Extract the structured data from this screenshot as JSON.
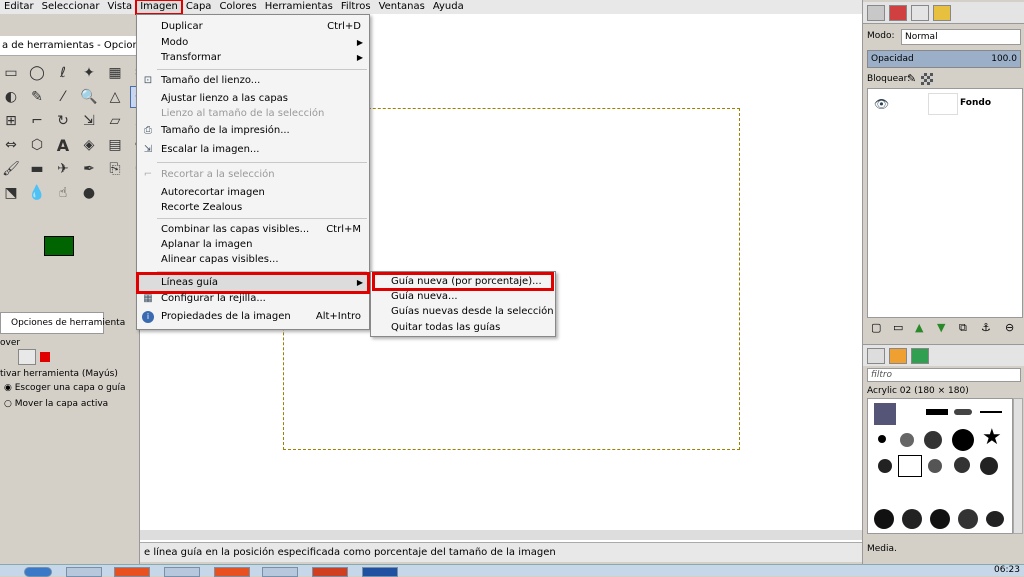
{
  "menubar": {
    "items": [
      "Editar",
      "Seleccionar",
      "Vista",
      "Imagen",
      "Capa",
      "Colores",
      "Herramientas",
      "Filtros",
      "Ventanas",
      "Ayuda"
    ]
  },
  "toolbox": {
    "title": "a de herramientas - Opcion...",
    "options_tab": "Opciones de herramienta",
    "opt_mover": "over",
    "opt_activar": "tivar herramienta  (Mayús)",
    "opt_radio1": "Escoger una capa o guía",
    "opt_radio2": "Mover la capa activa"
  },
  "imagen_menu": {
    "items": [
      {
        "label": "Duplicar",
        "shortcut": "Ctrl+D"
      },
      {
        "label": "Modo"
      },
      {
        "label": "Transformar"
      },
      {
        "label": "Tamaño del lienzo..."
      },
      {
        "label": "Ajustar lienzo a las capas"
      },
      {
        "label": "Lienzo al tamaño de la selección"
      },
      {
        "label": "Tamaño de la impresión..."
      },
      {
        "label": "Escalar la imagen..."
      },
      {
        "label": "Recortar a la selección"
      },
      {
        "label": "Autorecortar imagen"
      },
      {
        "label": "Recorte Zealous"
      },
      {
        "label": "Combinar las capas visibles...",
        "shortcut": "Ctrl+M"
      },
      {
        "label": "Aplanar la imagen"
      },
      {
        "label": "Alinear capas visibles..."
      },
      {
        "label": "Líneas guía"
      },
      {
        "label": "Configurar la rejilla..."
      },
      {
        "label": "Propiedades de la imagen",
        "shortcut": "Alt+Intro"
      }
    ]
  },
  "guias_submenu": {
    "items": [
      "Guía nueva (por porcentaje)...",
      "Guía nueva...",
      "Guías nuevas desde la selección",
      "Quitar todas las guías"
    ]
  },
  "status": {
    "text": "e línea guía en la posición especificada como porcentaje del tamaño de la imagen"
  },
  "dock": {
    "mode_label": "Modo:",
    "mode_value": "Normal",
    "opacity_label": "Opacidad",
    "opacity_value": "100.0",
    "lock_label": "Bloquear:",
    "layer_name": "Fondo",
    "filter_placeholder": "filtro",
    "brush_name": "Acrylic 02 (180 × 180)",
    "media_label": "Media."
  },
  "taskbar": {
    "clock": "06:23"
  }
}
